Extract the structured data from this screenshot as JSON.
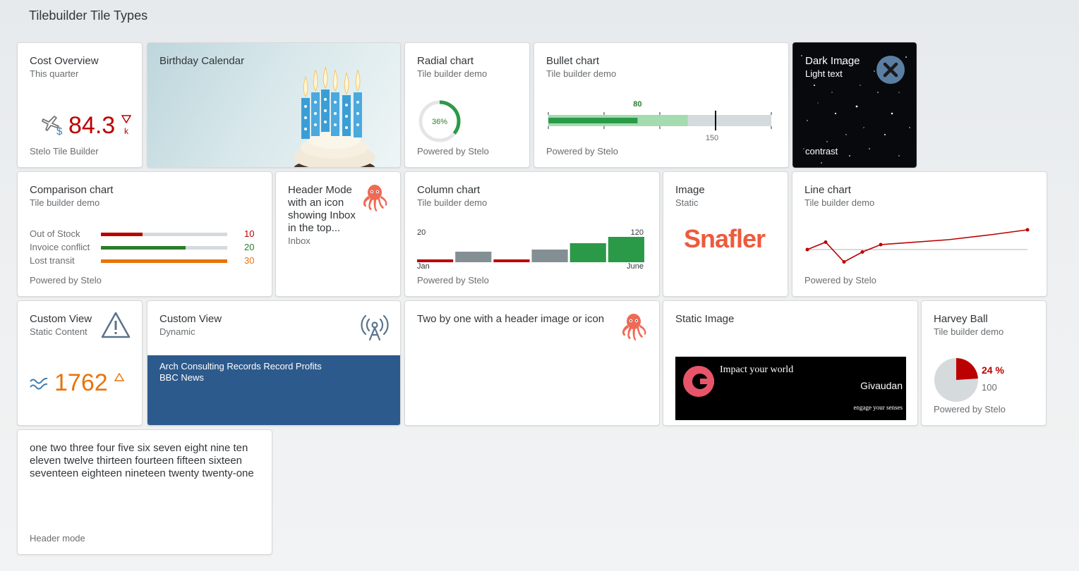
{
  "page": {
    "title": "Tilebuilder Tile Types"
  },
  "colors": {
    "negative": "#bb0000",
    "positive": "#2b7d2b",
    "critical": "#e9730c",
    "neutral": "#8c9196",
    "accent": "#427cac"
  },
  "tiles": {
    "cost_overview": {
      "title": "Cost Overview",
      "subtitle": "This quarter",
      "value": "84.3",
      "unit": "k",
      "icon": "airplane-dollar-icon",
      "footer": "Stelo Tile Builder"
    },
    "birthday_calendar": {
      "title": "Birthday Calendar",
      "image": "birthday-cupcake-candles"
    },
    "radial_chart": {
      "title": "Radial chart",
      "subtitle": "Tile builder demo",
      "value_label": "36%",
      "percent": 36,
      "footer": "Powered by Stelo"
    },
    "bullet_chart": {
      "title": "Bullet chart",
      "subtitle": "Tile builder demo",
      "value_label": "80",
      "target_label": "150",
      "actual": 80,
      "forecast": 125,
      "target": 150,
      "max": 200,
      "footer": "Powered by Stelo"
    },
    "dark_image": {
      "title": "Dark Image",
      "subtitle": "Light text",
      "footer": "contrast",
      "icon": "close-circle-icon"
    },
    "comparison_chart": {
      "title": "Comparison chart",
      "subtitle": "Tile builder demo",
      "footer": "Powered by Stelo",
      "rows": [
        {
          "label": "Out of Stock",
          "value": "10",
          "fraction": 0.33,
          "color": "#bb0000"
        },
        {
          "label": "Invoice conflict",
          "value": "20",
          "fraction": 0.67,
          "color": "#2b7d2b"
        },
        {
          "label": "Lost transit",
          "value": "30",
          "fraction": 1.0,
          "color": "#e9730c"
        }
      ]
    },
    "header_mode_icon": {
      "title": "Header Mode with an icon showing Inbox in the top...",
      "subtitle": "Inbox",
      "icon": "octopus-icon"
    },
    "column_chart": {
      "title": "Column chart",
      "subtitle": "Tile builder demo",
      "footer": "Powered by Stelo",
      "left_value": "20",
      "right_value": "120",
      "left_label": "Jan",
      "right_label": "June",
      "columns": [
        {
          "value": 20,
          "color": "#bb0000"
        },
        {
          "value": 50,
          "color": "#848f94"
        },
        {
          "value": 30,
          "color": "#bb0000"
        },
        {
          "value": 60,
          "color": "#848f94"
        },
        {
          "value": 90,
          "color": "#2b9a48"
        },
        {
          "value": 120,
          "color": "#2b9a48"
        }
      ]
    },
    "image_static": {
      "title": "Image",
      "subtitle": "Static",
      "logo_text": "Snafler"
    },
    "line_chart": {
      "title": "Line chart",
      "subtitle": "Tile builder demo",
      "footer": "Powered by Stelo",
      "points": [
        40,
        55,
        15,
        35,
        50,
        60,
        70,
        80
      ],
      "threshold": 40
    },
    "custom_view_static": {
      "title": "Custom View",
      "subtitle": "Static Content",
      "value": "1762",
      "icon": "warning-icon",
      "trend_icon": "trend-waves-icon"
    },
    "custom_view_dynamic": {
      "title": "Custom View",
      "subtitle": "Dynamic",
      "icon": "broadcast-tower-icon",
      "news_headline": "Arch Consulting Records Record Profits",
      "news_source": "BBC News"
    },
    "two_by_one": {
      "title": "Two by one with a header image or icon",
      "icon": "octopus-icon"
    },
    "static_image": {
      "title": "Static Image",
      "banner_headline": "Impact your world",
      "banner_brand": "Givaudan",
      "banner_tagline": "engage your senses"
    },
    "harvey_ball": {
      "title": "Harvey Ball",
      "subtitle": "Tile builder demo",
      "value_label": "24 %",
      "total_label": "100",
      "percent": 24,
      "footer": "Powered by Stelo"
    },
    "text_tile": {
      "text": "one two three four five six seven eight nine ten eleven twelve thirteen fourteen fifteen sixteen seventeen eighteen nineteen twenty twenty-one",
      "footer": "Header mode"
    }
  }
}
